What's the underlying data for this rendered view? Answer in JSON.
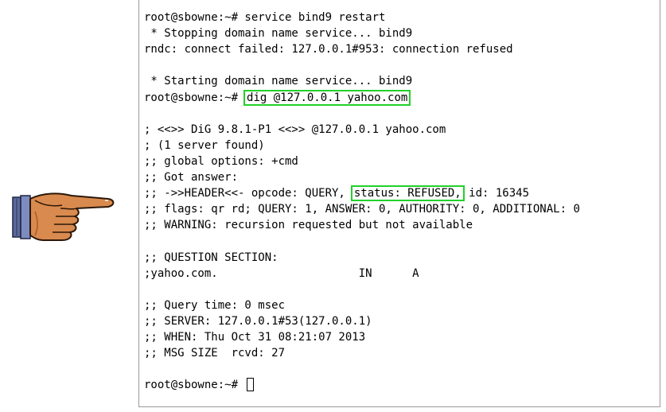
{
  "terminal": {
    "lines": [
      "root@sbowne:~# service bind9 restart",
      " * Stopping domain name service... bind9",
      "rndc: connect failed: 127.0.0.1#953: connection refused",
      "",
      " * Starting domain name service... bind9",
      "",
      "",
      "; <<>> DiG 9.8.1-P1 <<>> @127.0.0.1 yahoo.com",
      "; (1 server found)",
      ";; global options: +cmd",
      ";; Got answer:",
      "",
      ";; flags: qr rd; QUERY: 1, ANSWER: 0, AUTHORITY: 0, ADDITIONAL: 0",
      ";; WARNING: recursion requested but not available",
      "",
      ";; QUESTION SECTION:",
      ";yahoo.com.                     IN      A",
      "",
      ";; Query time: 0 msec",
      ";; SERVER: 127.0.0.1#53(127.0.0.1)",
      ";; WHEN: Thu Oct 31 08:21:07 2013",
      ";; MSG SIZE  rcvd: 27",
      "",
      "root@sbowne:~# "
    ],
    "dig_prompt": "root@sbowne:~#",
    "dig_command": "dig @127.0.0.1 yahoo.com",
    "header_prefix": ";; ->>HEADER<<- opcode: QUERY,",
    "header_status": "status: REFUSED,",
    "header_suffix": " id: 16345",
    "highlight_color": "#22d12a"
  },
  "pointer": {
    "icon": "pointing-hand-icon"
  }
}
